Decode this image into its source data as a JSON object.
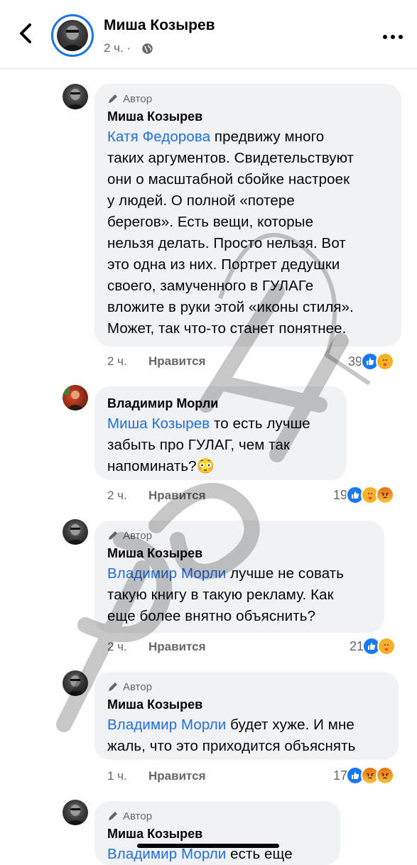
{
  "header": {
    "name": "Миша Козырев",
    "time": "2 ч. ·",
    "icons": {
      "back": "chevron-left-icon",
      "privacy": "globe-icon",
      "more": "more-horizontal-icon"
    }
  },
  "comments": [
    {
      "author_badge": "Автор",
      "name": "Миша Козырев",
      "mention": "Катя Федорова",
      "lines": [
        " предвижу много",
        "таких аргументов. Свидетельствуют",
        "они о масштабной сбойке настроек",
        "у людей. О полной «потере",
        "берегов». Есть вещи, которые",
        "нельзя делать. Просто нельзя. Вот",
        "это одна из них. Портрет дедушки",
        "своего, замученного в ГУЛАГе",
        "вложите в руки этой «иконы стиля».",
        "Может, так что-то станет понятнее."
      ],
      "time": "2 ч.",
      "like": "Нравится",
      "count": "39",
      "reactions": [
        "like",
        "care"
      ]
    },
    {
      "name": "Владимир Морли",
      "mention": "Миша Козырев",
      "lines": [
        " то есть лучше",
        "забыть про ГУЛАГ, чем так",
        "напоминать?😳"
      ],
      "time": "2 ч.",
      "like": "Нравится",
      "count": "19",
      "reactions": [
        "like",
        "care",
        "angry"
      ]
    },
    {
      "author_badge": "Автор",
      "name": "Миша Козырев",
      "mention": "Владимир Морли",
      "lines": [
        " лучше не совать",
        "такую книгу в такую рекламу. Как",
        "еще более внятно объяснить?"
      ],
      "time": "2 ч.",
      "like": "Нравится",
      "count": "21",
      "reactions": [
        "like",
        "care"
      ]
    },
    {
      "author_badge": "Автор",
      "name": "Миша Козырев",
      "mention": "Владимир Морли",
      "lines": [
        " будет хуже. И мне",
        "жаль, что это приходится объяснять"
      ],
      "time": "1 ч.",
      "like": "Нравится",
      "count": "17",
      "reactions": [
        "like",
        "angry",
        "angry"
      ]
    },
    {
      "author_badge": "Автор",
      "name": "Миша Козырев",
      "mention": "Владимир Морли",
      "lines": [
        " есть еще"
      ]
    }
  ],
  "watermark": "РЕН ТВ",
  "colors": {
    "mention": "#216fdb",
    "bubble": "#f0f2f5",
    "meta": "#65676b",
    "accent": "#1b74e4"
  }
}
